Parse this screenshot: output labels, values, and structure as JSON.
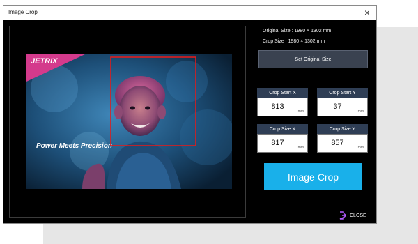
{
  "window": {
    "title": "Image Crop"
  },
  "preview": {
    "logo": "JETRIX",
    "watermark": "Power Meets Precision"
  },
  "info": {
    "original_size": "Original Size : 1980 × 1302 mm",
    "crop_size": "Crop Size : 1980 × 1302 mm"
  },
  "buttons": {
    "set_original": "Set Original Size",
    "image_crop": "Image Crop",
    "close": "CLOSE"
  },
  "fields": {
    "crop_start_x": {
      "label": "Crop Start X",
      "value": "813",
      "unit": "mm"
    },
    "crop_start_y": {
      "label": "Crop Start Y",
      "value": "37",
      "unit": "mm"
    },
    "crop_size_x": {
      "label": "Crop Size X",
      "value": "817",
      "unit": "mm"
    },
    "crop_size_y": {
      "label": "Crop Size Y",
      "value": "857",
      "unit": "mm"
    }
  },
  "colors": {
    "accent": "#19b0ea",
    "field_header": "#2f3e55",
    "crop_rect": "#e21b1b",
    "logo_banner": "#d43a8c",
    "close_icon": "#b45cff"
  }
}
